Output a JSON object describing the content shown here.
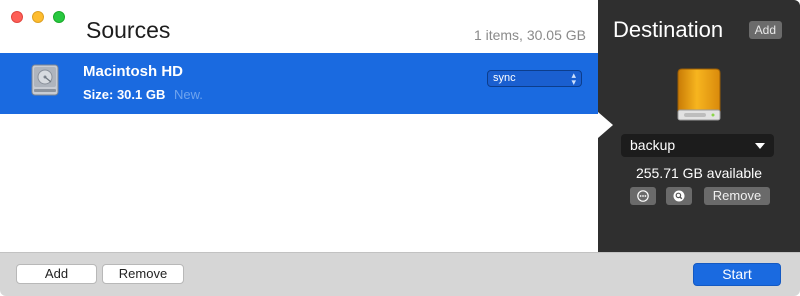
{
  "window": {
    "traffic_lights": [
      "close",
      "minimize",
      "zoom"
    ]
  },
  "sources": {
    "title": "Sources",
    "summary": "1 items, 30.05 GB",
    "items": [
      {
        "name": "Macintosh HD",
        "size": "Size: 30.1 GB",
        "tag": "New.",
        "mode": "sync",
        "icon": "internal-drive-icon",
        "selected": true
      }
    ]
  },
  "destination": {
    "title": "Destination",
    "add_label": "Add",
    "icon": "external-drive-icon",
    "selected_volume": "backup",
    "available": "255.71 GB available",
    "remove_label": "Remove"
  },
  "footer": {
    "add_label": "Add",
    "remove_label": "Remove",
    "start_label": "Start"
  },
  "colors": {
    "accent": "#1a6ae0",
    "dest_bg": "#2f2f2f",
    "drive_orange": "#f2a516"
  }
}
